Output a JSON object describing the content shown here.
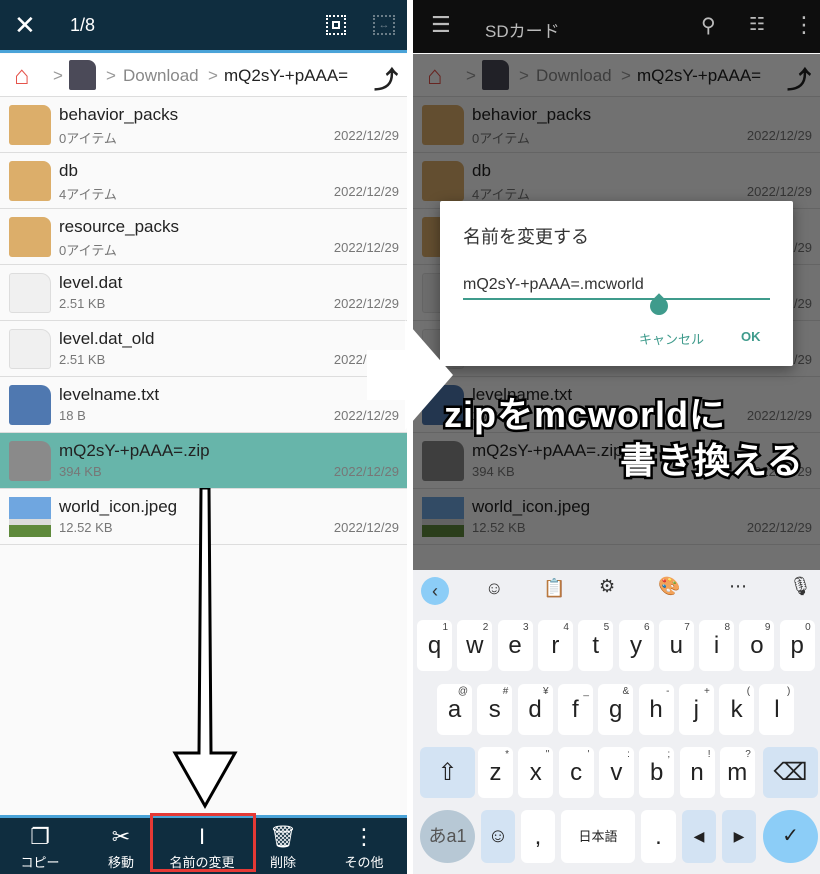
{
  "left": {
    "header": {
      "close_icon": "close-icon",
      "count": "1/8"
    },
    "breadcrumb": {
      "items": [
        "Download",
        "mQ2sY-+pAAA="
      ]
    },
    "files": [
      {
        "name": "behavior_packs",
        "sub": "0アイテム",
        "date": "2022/12/29",
        "type": "folder"
      },
      {
        "name": "db",
        "sub": "4アイテム",
        "date": "2022/12/29",
        "type": "folder"
      },
      {
        "name": "resource_packs",
        "sub": "0アイテム",
        "date": "2022/12/29",
        "type": "folder"
      },
      {
        "name": "level.dat",
        "sub": "2.51 KB",
        "date": "2022/12/29",
        "type": "file"
      },
      {
        "name": "level.dat_old",
        "sub": "2.51 KB",
        "date": "2022/12/29",
        "type": "file"
      },
      {
        "name": "levelname.txt",
        "sub": "18 B",
        "date": "2022/12/29",
        "type": "text"
      },
      {
        "name": "mQ2sY-+pAAA=.zip",
        "sub": "394 KB",
        "date": "2022/12/29",
        "type": "zip",
        "selected": true
      },
      {
        "name": "world_icon.jpeg",
        "sub": "12.52 KB",
        "date": "2022/12/29",
        "type": "image"
      }
    ],
    "bottom_bar": [
      {
        "label": "コピー",
        "icon": "copy-icon",
        "glyph": "❐"
      },
      {
        "label": "移動",
        "icon": "scissors-icon",
        "glyph": "✂"
      },
      {
        "label": "名前の変更",
        "icon": "text-cursor-icon",
        "glyph": "I",
        "highlighted": true
      },
      {
        "label": "削除",
        "icon": "trash-icon",
        "glyph": "🗑"
      },
      {
        "label": "その他",
        "icon": "more-vert-icon",
        "glyph": "⋮"
      }
    ]
  },
  "right": {
    "header": {
      "title": "SDカード"
    },
    "dialog": {
      "title": "名前を変更する",
      "value": "mQ2sY-+pAAA=.mcworld",
      "cancel": "キャンセル",
      "ok": "OK"
    },
    "keyboard": {
      "rows": [
        [
          [
            "q",
            "1"
          ],
          [
            "w",
            "2"
          ],
          [
            "e",
            "3"
          ],
          [
            "r",
            "4"
          ],
          [
            "t",
            "5"
          ],
          [
            "y",
            "6"
          ],
          [
            "u",
            "7"
          ],
          [
            "i",
            "8"
          ],
          [
            "o",
            "9"
          ],
          [
            "p",
            "0"
          ]
        ],
        [
          [
            "a",
            "@"
          ],
          [
            "s",
            "#"
          ],
          [
            "d",
            "¥"
          ],
          [
            "f",
            "_"
          ],
          [
            "g",
            "&"
          ],
          [
            "h",
            "-"
          ],
          [
            "j",
            "+"
          ],
          [
            "k",
            "("
          ],
          [
            "l",
            ")"
          ]
        ],
        [
          [
            "z",
            "*"
          ],
          [
            "x",
            "\""
          ],
          [
            "c",
            "'"
          ],
          [
            "v",
            ":"
          ],
          [
            "b",
            ";"
          ],
          [
            "n",
            "!"
          ],
          [
            "m",
            "?"
          ]
        ]
      ],
      "mode": "あa1",
      "comma": ",",
      "space": "日本語",
      "period": "."
    }
  },
  "caption": {
    "line1": "zipをmcworldに",
    "line2": "書き換える"
  },
  "colors": {
    "header": "#0f2d3f",
    "accent": "#4aa3d8",
    "selected": "#67b5aa",
    "highlight_box": "#e53935",
    "dialog_accent": "#3f9b8c"
  }
}
